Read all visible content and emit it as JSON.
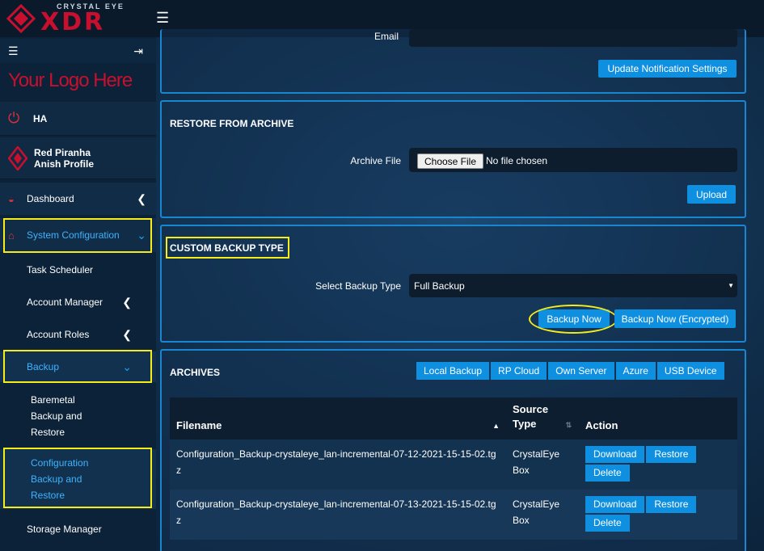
{
  "brand": {
    "small": "CRYSTAL EYE",
    "big": "XDR",
    "custom_logo": "Your Logo Here"
  },
  "sidebar": {
    "ha_label": "HA",
    "user": {
      "name": "Red Piranha",
      "profile": "Anish Profile"
    },
    "nav": {
      "dashboard": "Dashboard",
      "system_configuration": "System Configuration",
      "task_scheduler": "Task Scheduler",
      "account_manager": "Account Manager",
      "account_roles": "Account Roles",
      "backup": "Backup",
      "baremetal": [
        "Baremetal",
        "Backup and",
        "Restore"
      ],
      "configuration_backup": [
        "Configuration",
        "Backup and",
        "Restore"
      ],
      "storage_manager": "Storage Manager"
    }
  },
  "notification": {
    "email_label": "Email",
    "update_button": "Update Notification Settings"
  },
  "restore": {
    "title": "RESTORE FROM ARCHIVE",
    "archive_label": "Archive File",
    "choose_file": "Choose File",
    "no_file": "No file chosen",
    "upload_button": "Upload"
  },
  "custom_backup": {
    "title": "CUSTOM BACKUP TYPE",
    "select_label": "Select Backup Type",
    "selected": "Full Backup",
    "backup_now": "Backup Now",
    "backup_now_encrypted": "Backup Now (Encrypted)"
  },
  "archives": {
    "title": "ARCHIVES",
    "tabs": [
      "Local Backup",
      "RP Cloud",
      "Own Server",
      "Azure",
      "USB Device"
    ],
    "headers": {
      "filename": "Filename",
      "source": "Source Type",
      "action": "Action"
    },
    "rows": [
      {
        "filename": "Configuration_Backup-crystaleye_lan-incremental-07-12-2021-15-15-02.tgz",
        "source": "CrystalEye Box"
      },
      {
        "filename": "Configuration_Backup-crystaleye_lan-incremental-07-13-2021-15-15-02.tgz",
        "source": "CrystalEye Box"
      }
    ],
    "actions": {
      "download": "Download",
      "restore": "Restore",
      "delete": "Delete"
    }
  }
}
